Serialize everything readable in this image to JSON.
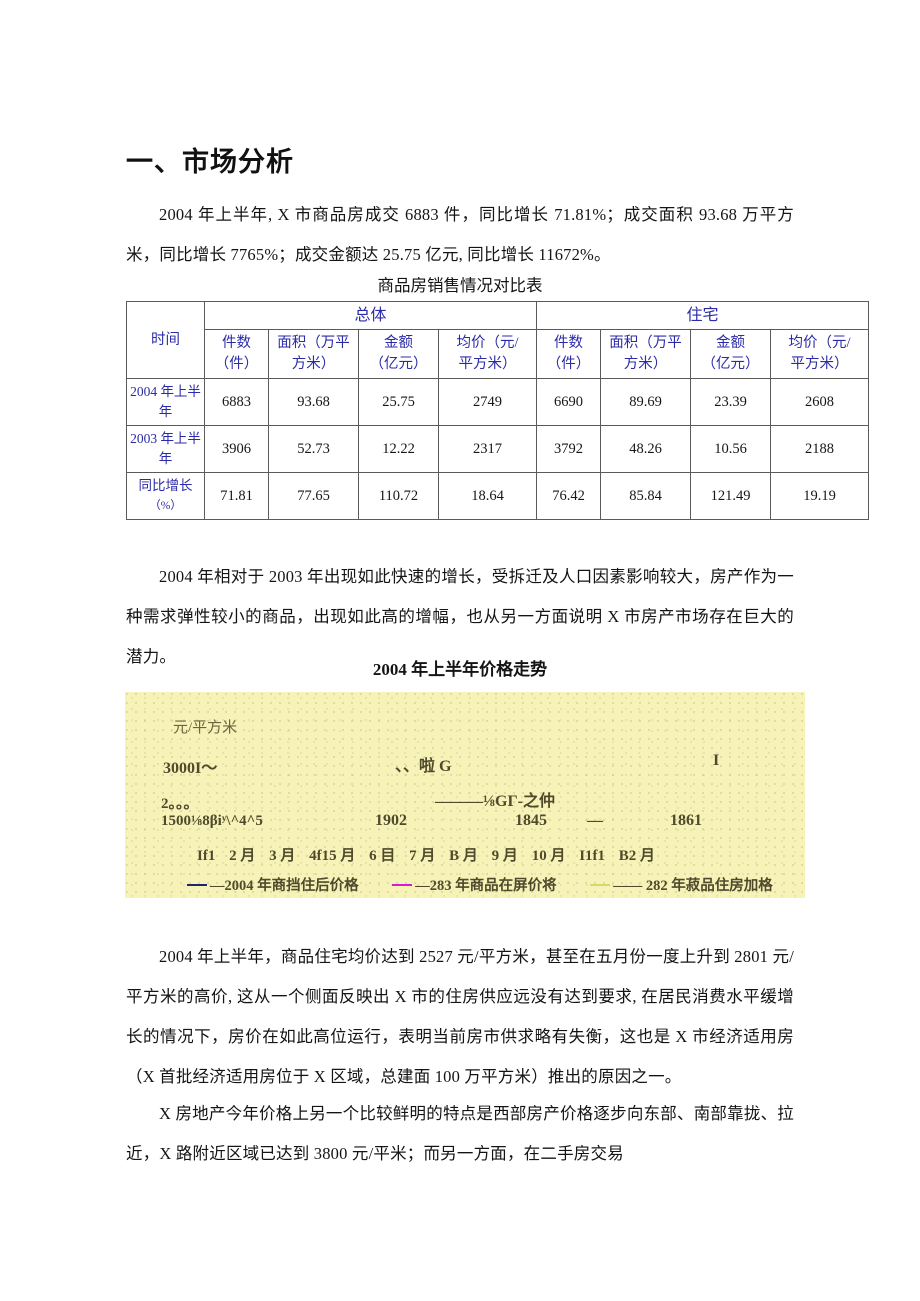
{
  "heading": "一、市场分析",
  "paragraphs": {
    "intro": "2004 年上半年, X 市商品房成交 6883 件，同比增长 71.81%；成交面积 93.68 万平方米，同比增长 7765%；成交金额达 25.75 亿元, 同比增长 11672%。",
    "mid": "2004 年相对于 2003 年出现如此快速的增长，受拆迁及人口因素影响较大，房产作为一种需求弹性较小的商品，出现如此高的增幅，也从另一方面说明 X 市房产市场存在巨大的潜力。",
    "after_chart": "2004 年上半年，商品住宅均价达到 2527 元/平方米，甚至在五月份一度上升到 2801 元/平方米的高价, 这从一个侧面反映出 X 市的住房供应远没有达到要求, 在居民消费水平缓增长的情况下，房价在如此高位运行，表明当前房市供求略有失衡，这也是 X 市经济适用房（X 首批经济适用房位于 X 区域，总建面 100 万平方米）推出的原因之一。",
    "last": "X 房地产今年价格上另一个比较鲜明的特点是西部房产价格逐步向东部、南部靠拢、拉近，X 路附近区域已达到 3800 元/平米；而另一方面，在二手房交易"
  },
  "table": {
    "caption": "商品房销售情况对比表",
    "time_header": "时间",
    "groups": [
      "总体",
      "住宅"
    ],
    "sub_headers": [
      {
        "l1": "件数",
        "l2": "（件）"
      },
      {
        "l1": "面积（万平",
        "l2": "方米）"
      },
      {
        "l1": "金额",
        "l2": "（亿元）"
      },
      {
        "l1": "均价（元/",
        "l2": "平方米）"
      }
    ],
    "rows": [
      {
        "label_l1": "2004 年上半",
        "label_l2": "年",
        "values": [
          "6883",
          "93.68",
          "25.75",
          "2749",
          "6690",
          "89.69",
          "23.39",
          "2608"
        ]
      },
      {
        "label_l1": "2003 年上半",
        "label_l2": "年",
        "values": [
          "3906",
          "52.73",
          "12.22",
          "2317",
          "3792",
          "48.26",
          "10.56",
          "2188"
        ]
      },
      {
        "label_l1": "同比增长",
        "label_l2": "（%）",
        "values": [
          "71.81",
          "77.65",
          "110.72",
          "18.64",
          "76.42",
          "85.84",
          "121.49",
          "19.19"
        ]
      }
    ]
  },
  "chart_data": {
    "type": "line",
    "title": "2004 年上半年价格走势",
    "ylabel": "元/平方米",
    "xlabel": "",
    "grid": false,
    "legend_position": "bottom",
    "y_tick_visible": "3000",
    "tick_labels": [
      "3000"
    ],
    "categories": [
      "If1",
      "2 月",
      "3 月",
      "4f15 月",
      "6 目",
      "7 月",
      "B 月",
      "9 月",
      "10 月",
      "I1f1",
      "B2 月"
    ],
    "annotations": {
      "glyph_ytick": "3000I〜",
      "glyph_mid": "、、啦 G",
      "glyph_right": "I",
      "fragment_row2": "2。。。",
      "fragment_row2b": "1500⅛8βiʸ\\^4^5",
      "fragment_a": "———⅛GΓ-之仲",
      "dash_mid": "—"
    },
    "values_shown": [
      "1902",
      "1845",
      "1861"
    ],
    "series": [
      {
        "name": "—2004 年商挡住后价格",
        "color": "#23236e",
        "values": []
      },
      {
        "name": "—283 年商品在屏价将",
        "color": "#d51bd5",
        "values": []
      },
      {
        "name": "—— 282 年菽品住房加格",
        "color": "#d8d86a",
        "values": []
      }
    ],
    "background_color": "#f7f3b8"
  }
}
